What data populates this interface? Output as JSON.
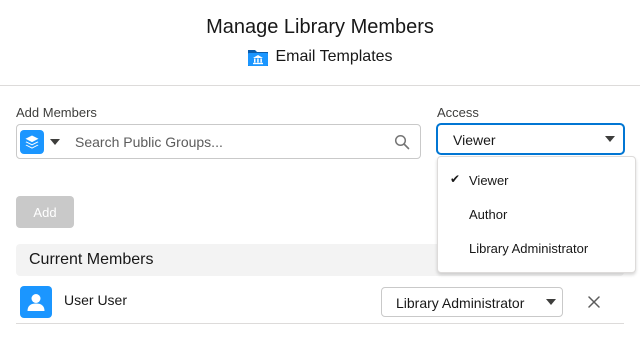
{
  "header": {
    "title": "Manage Library Members",
    "library_name": "Email Templates",
    "library_icon": "library-folder-icon"
  },
  "add_members": {
    "label": "Add Members",
    "group_type_icon": "layers-icon",
    "search_placeholder": "Search Public Groups...",
    "search_icon": "search-icon"
  },
  "access": {
    "label": "Access",
    "selected": "Viewer",
    "options": [
      {
        "label": "Viewer",
        "checked": true
      },
      {
        "label": "Author",
        "checked": false
      },
      {
        "label": "Library Administrator",
        "checked": false
      }
    ],
    "check_glyph": "✔"
  },
  "add_button": {
    "label": "Add",
    "disabled": true
  },
  "current_members": {
    "title": "Current Members",
    "members": [
      {
        "name": "User User",
        "access": "Library Administrator",
        "avatar_icon": "user-icon"
      }
    ]
  },
  "colors": {
    "brand": "#1b96ff",
    "focus": "#0176d3",
    "disabled": "#c9c9c9",
    "section_bg": "#f3f3f3"
  }
}
